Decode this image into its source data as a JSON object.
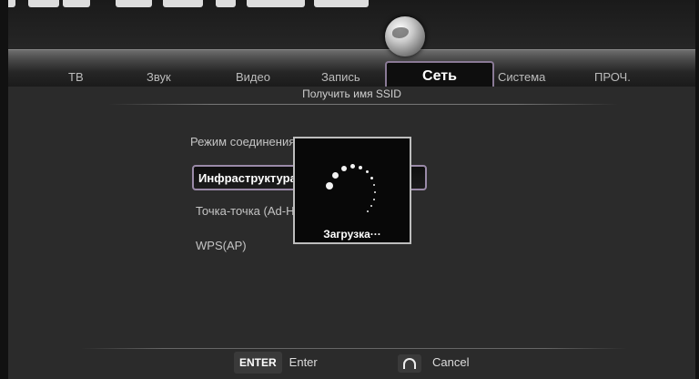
{
  "tabs": [
    {
      "label": "ТВ",
      "active": false
    },
    {
      "label": "Звук",
      "active": false
    },
    {
      "label": "Видео",
      "active": false
    },
    {
      "label": "Запись",
      "active": false
    },
    {
      "label": "Сеть",
      "active": true
    },
    {
      "label": "Система",
      "active": false
    },
    {
      "label": "ПРОЧ.",
      "active": false
    }
  ],
  "subtitle": "Получить имя SSID",
  "options": {
    "label": "Режим соединения",
    "items": [
      "Инфраструктура",
      "Точка-точка (Ad-Hoc)",
      "WPS(AP)"
    ],
    "selected_index": 0
  },
  "popup": {
    "text": "Загрузка···"
  },
  "footer": {
    "enter_key": "ENTER",
    "enter_label": "Enter",
    "cancel_label": "Cancel"
  },
  "icons": {
    "network": "globe-icon",
    "loading": "spinner-icon",
    "back": "return-icon"
  }
}
